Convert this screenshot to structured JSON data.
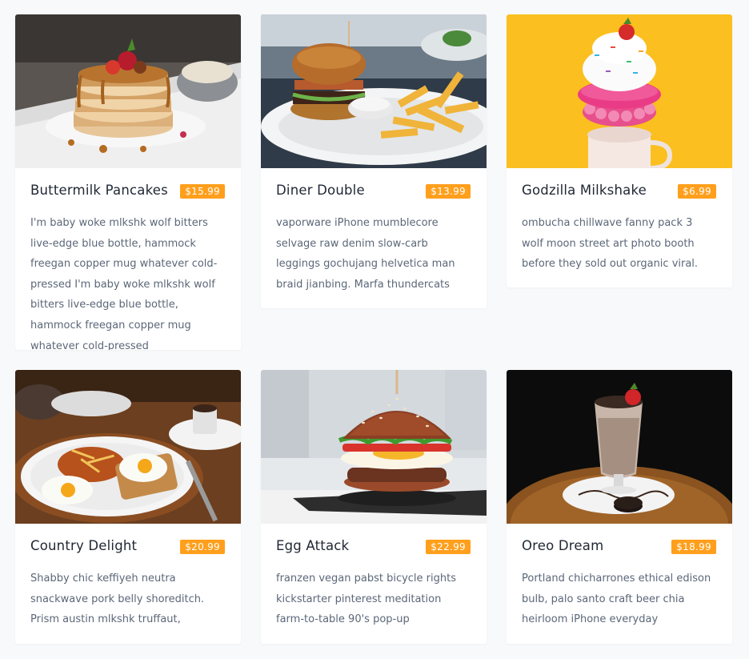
{
  "colors": {
    "background": "#f8f9fb",
    "card": "#ffffff",
    "price_badge": "#ff9f1c",
    "title_text": "#1f2733",
    "body_text": "#5b6778"
  },
  "menu": {
    "items": [
      {
        "title": "Buttermilk Pancakes",
        "price": "$15.99",
        "description": "I'm baby woke mlkshk wolf bitters live-edge blue bottle, hammock freegan copper mug whatever cold-pressed I'm baby woke mlkshk wolf bitters live-edge blue bottle, hammock freegan copper mug whatever cold-pressed",
        "image_icon": "pancakes-photo"
      },
      {
        "title": "Diner Double",
        "price": "$13.99",
        "description": "vaporware iPhone mumblecore selvage raw denim slow-carb leggings gochujang helvetica man braid jianbing. Marfa thundercats",
        "image_icon": "burger-fries-photo"
      },
      {
        "title": "Godzilla Milkshake",
        "price": "$6.99",
        "description": "ombucha chillwave fanny pack 3 wolf moon street art photo booth before they sold out organic viral.",
        "image_icon": "milkshake-photo"
      },
      {
        "title": "Country Delight",
        "price": "$20.99",
        "description": "Shabby chic keffiyeh neutra snackwave pork belly shoreditch. Prism austin mlkshk truffaut,",
        "image_icon": "breakfast-plate-photo"
      },
      {
        "title": "Egg Attack",
        "price": "$22.99",
        "description": "franzen vegan pabst bicycle rights kickstarter pinterest meditation farm-to-table 90's pop-up",
        "image_icon": "egg-burger-photo"
      },
      {
        "title": "Oreo Dream",
        "price": "$18.99",
        "description": "Portland chicharrones ethical edison bulb, palo santo craft beer chia heirloom iPhone everyday",
        "image_icon": "oreo-shake-photo"
      }
    ]
  }
}
